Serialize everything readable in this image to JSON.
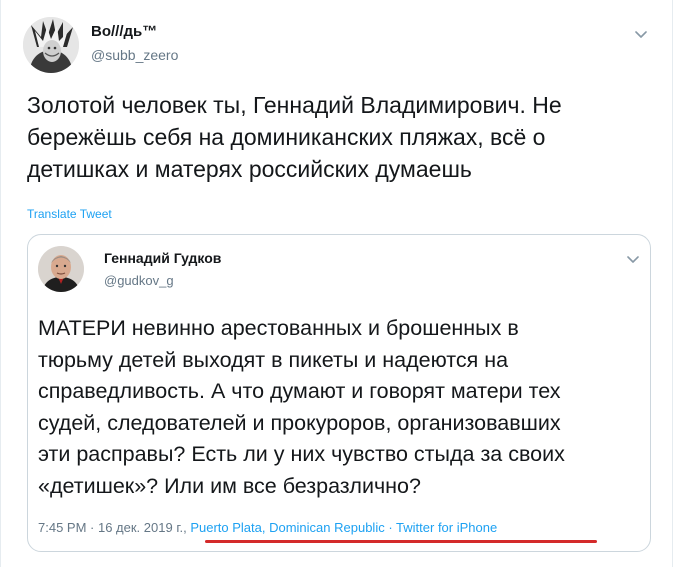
{
  "tweet": {
    "author_name": "Во///дь™",
    "author_handle": "@subb_zeero",
    "text": "Золотой человек ты, Геннадий Владимирович. Не\nбережёшь себя на доминиканских пляжах, всё о\nдетишках и матерях российских думаешь",
    "translate_label": "Translate Tweet"
  },
  "quoted_tweet": {
    "author_name": "Геннадий Гудков",
    "author_handle": "@gudkov_g",
    "text": "МАТЕРИ невинно арестованных и брошенных в\nтюрьму детей выходят в пикеты и надеются на\nсправедливость. А что думают и говорят матери тех\nсудей, следователей и прокуроров, организовавших\nэти расправы? Есть ли у них чувство стыда за своих\n«детишек»? Или им все безразлично?",
    "time": "7:45 PM",
    "date": "16 дек. 2019 г.",
    "sep": " · ",
    "location": "Puerto Plata, Dominican Republic",
    "source": "Twitter for iPhone"
  },
  "colors": {
    "link": "#1da1f2",
    "muted": "#657786",
    "text": "#14171a",
    "border": "#ccd6dd",
    "annotation_underline": "#d42a2a"
  },
  "icons": {
    "tweet_menu": "chevron-down-icon",
    "quote_menu": "chevron-down-icon"
  }
}
